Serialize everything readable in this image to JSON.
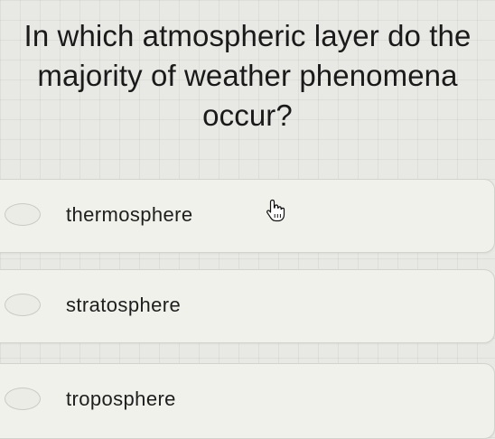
{
  "question": {
    "line1": "In which atmospheric layer do the",
    "line2": "majority of weather phenomena occur?"
  },
  "options": [
    {
      "label": "thermosphere",
      "selected": false
    },
    {
      "label": "stratosphere",
      "selected": false
    },
    {
      "label": "troposphere",
      "selected": false
    }
  ],
  "cursor": {
    "icon": "hand-pointer-icon"
  }
}
